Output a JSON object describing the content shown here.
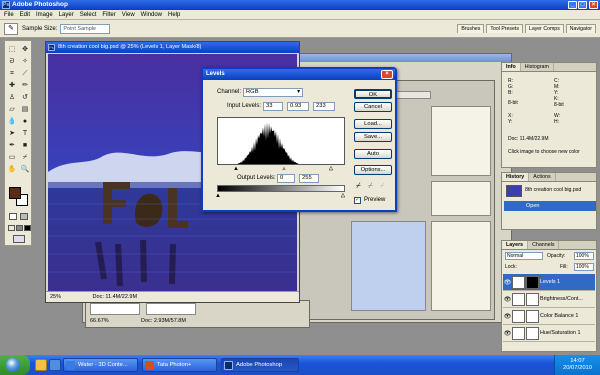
{
  "app": {
    "title": "Adobe Photoshop",
    "icon": "Ps"
  },
  "menu": [
    "File",
    "Edit",
    "Image",
    "Layer",
    "Select",
    "Filter",
    "View",
    "Window",
    "Help"
  ],
  "options_bar": {
    "sample_size_label": "Sample Size:",
    "sample_size_value": "Point Sample"
  },
  "panel_well_tabs": [
    "Brushes",
    "Tool Presets",
    "Layer Comps",
    "Navigator"
  ],
  "document": {
    "title": "8th creation cool big.psd @ 25% (Levels 1, Layer Mask/8)",
    "zoom": "25%",
    "doc_size": "Doc: 11.4M/22.9M"
  },
  "back_documents": [
    {
      "zoom": "66.67%",
      "doc_size": "Doc: 2.93M/57.8M"
    }
  ],
  "levels_dialog": {
    "title": "Levels",
    "channel_label": "Channel:",
    "channel_value": "RGB",
    "input_label": "Input Levels:",
    "input_black": "33",
    "input_gamma": "0.93",
    "input_white": "233",
    "output_label": "Output Levels:",
    "output_black": "0",
    "output_white": "255",
    "buttons": {
      "ok": "OK",
      "cancel": "Cancel",
      "load": "Load...",
      "save": "Save...",
      "auto": "Auto",
      "options": "Options..."
    },
    "preview_label": "Preview"
  },
  "info_panel": {
    "tabs": [
      "Info",
      "Histogram"
    ],
    "rgb_labels": [
      "R:",
      "G:",
      "B:"
    ],
    "cmyk_labels": [
      "C:",
      "M:",
      "Y:",
      "K:"
    ],
    "bit_label": "8-bit",
    "xy_labels": [
      "X:",
      "Y:"
    ],
    "wh_labels": [
      "W:",
      "H:"
    ],
    "doc": "Doc: 11.4M/22.9M",
    "hint": "Click image to choose new color"
  },
  "history_panel": {
    "tabs": [
      "History",
      "Actions"
    ],
    "snapshot": "8th creation cool big.psd",
    "items": [
      "Open"
    ]
  },
  "layers_panel": {
    "tabs": [
      "Layers",
      "Channels"
    ],
    "blend_mode": "Normal",
    "opacity_label": "Opacity:",
    "opacity": "100%",
    "lock_label": "Lock:",
    "fill_label": "Fill:",
    "fill": "100%",
    "layers": [
      {
        "name": "Levels 1",
        "selected": true
      },
      {
        "name": "Brightness/Cont...",
        "selected": false
      },
      {
        "name": "Color Balance 1",
        "selected": false
      },
      {
        "name": "Hue/Saturation 1",
        "selected": false
      }
    ]
  },
  "taskbar": {
    "buttons": [
      {
        "label": "Water - 3D Conte...",
        "active": false
      },
      {
        "label": "Tata Photon+",
        "active": false
      },
      {
        "label": "Adobe Photoshop",
        "active": true
      }
    ],
    "time": "14:07",
    "date": "20/07/2010"
  },
  "colors": {
    "foreground": "#5a2c14",
    "background": "#ffffff",
    "title_bar": "#0a3fc2",
    "selection": "#316ac5"
  }
}
